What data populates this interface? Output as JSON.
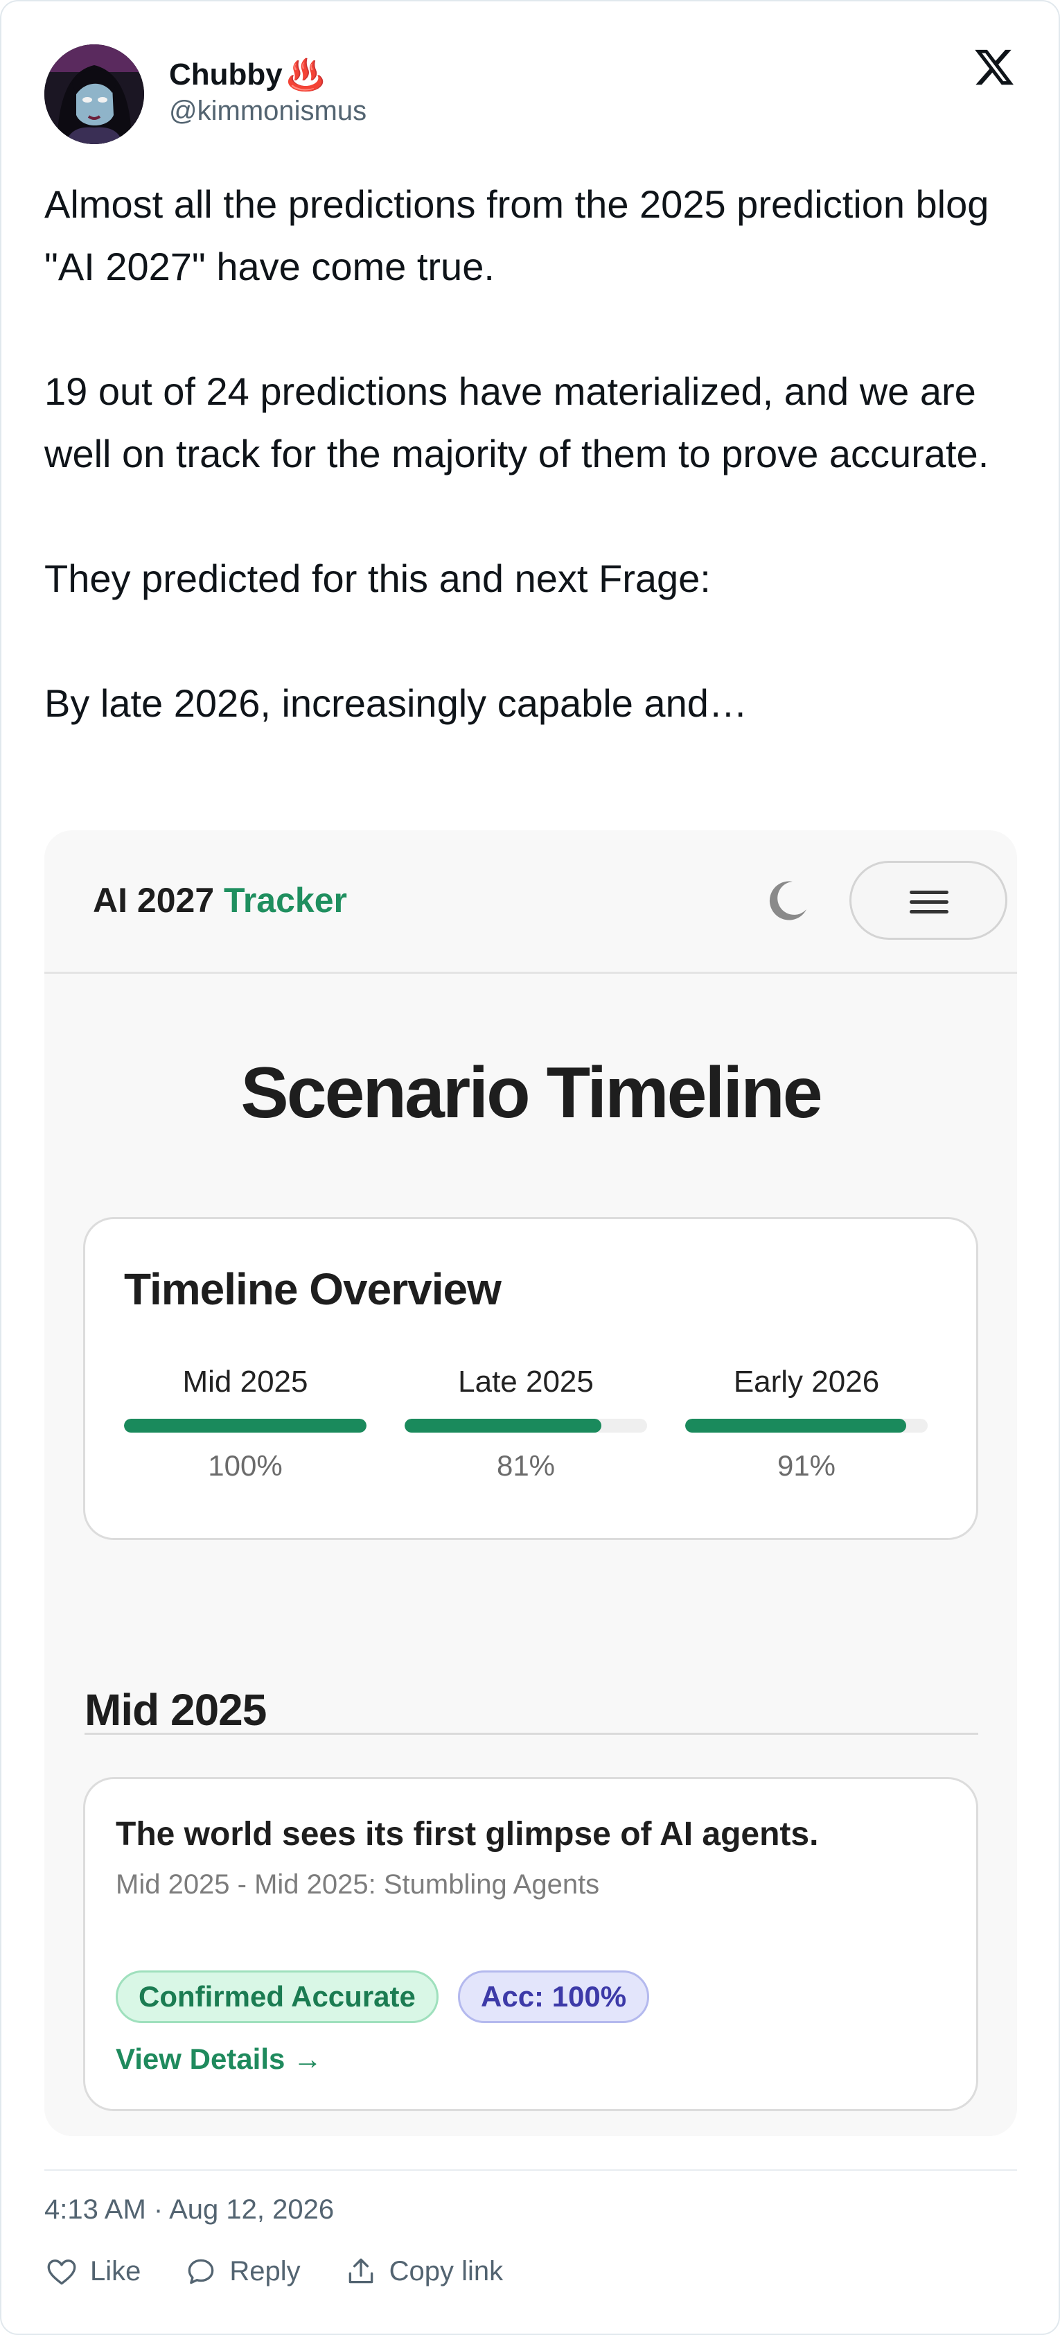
{
  "author": {
    "name": "Chubby",
    "name_emoji": "♨️",
    "handle": "@kimmonismus"
  },
  "tweet": {
    "paragraphs": [
      "Almost all the predictions from the 2025 prediction blog \"AI 2027\" have come true.",
      "19 out of 24 predictions have materialized, and we are well on track for the majority of them to prove accurate.",
      "They predicted for this and next Frage:",
      "By late 2026, increasingly capable and…"
    ]
  },
  "embedded": {
    "brand_main": "AI 2027",
    "brand_accent": "Tracker",
    "page_title": "Scenario Timeline",
    "overview": {
      "title": "Timeline Overview",
      "phases": [
        {
          "label": "Mid 2025",
          "percent_label": "100%",
          "progress": 1.0
        },
        {
          "label": "Late 2025",
          "percent_label": "81%",
          "progress": 0.81
        },
        {
          "label": "Early 2026",
          "percent_label": "91%",
          "progress": 0.91
        }
      ]
    },
    "section_title": "Mid 2025",
    "event": {
      "title": "The world sees its first glimpse of AI agents.",
      "subtitle": "Mid 2025 - Mid 2025: Stumbling Agents",
      "badge_status": "Confirmed Accurate",
      "badge_accuracy": "Acc: 100%",
      "link": "View Details →"
    },
    "colors": {
      "accent": "#1f8f5f",
      "progress": "#1a8a5c",
      "badge_green_bg": "#d9f7e6",
      "badge_purple_bg": "#e3e5fb"
    }
  },
  "footer": {
    "timestamp": "4:13 AM · Aug 12, 2026",
    "actions": [
      {
        "label": "Like",
        "icon": "heart-icon"
      },
      {
        "label": "Reply",
        "icon": "speech-bubble-icon"
      },
      {
        "label": "Copy link",
        "icon": "share-upload-icon"
      }
    ]
  },
  "icons": {
    "x_logo": "x-logo-icon",
    "theme_toggle": "moon-icon",
    "menu": "hamburger-icon"
  }
}
